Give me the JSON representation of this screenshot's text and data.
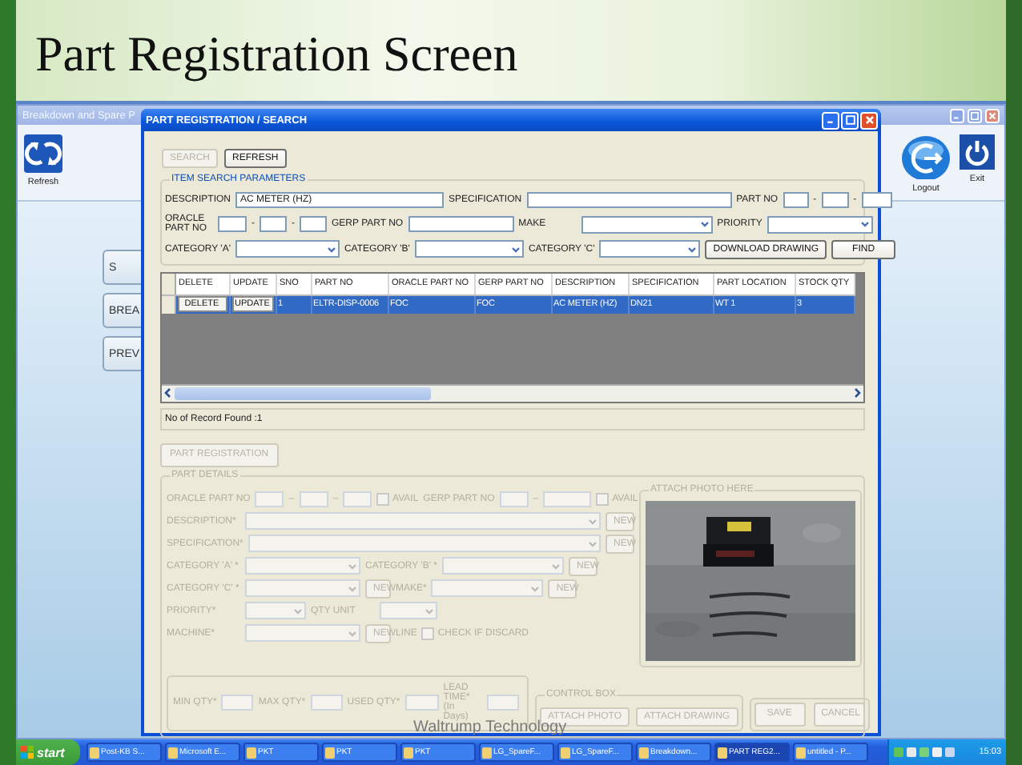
{
  "slide": {
    "title": "Part Registration Screen",
    "footer": "Waltrump Technology"
  },
  "main_window": {
    "title": "Breakdown and Spare P",
    "toolbar_left": [
      {
        "label": "Refresh"
      }
    ],
    "toolbar_right": [
      {
        "label": "Logout"
      },
      {
        "label": "Exit"
      }
    ],
    "menu_buttons": [
      "S",
      "BREA",
      "PREV"
    ]
  },
  "dialog": {
    "title": "PART REGISTRATION / SEARCH",
    "top_buttons": [
      {
        "label": "SEARCH",
        "disabled": true
      },
      {
        "label": "REFRESH",
        "disabled": false
      }
    ],
    "search_group": {
      "title": "ITEM SEARCH PARAMETERS",
      "rows": [
        {
          "fields": [
            {
              "kind": "label",
              "text": "DESCRIPTION"
            },
            {
              "kind": "input",
              "value": "AC METER (HZ)"
            },
            {
              "kind": "label",
              "text": "SPECIFICATION"
            },
            {
              "kind": "input"
            },
            {
              "kind": "label",
              "text": "PART NO"
            },
            {
              "kind": "input"
            },
            {
              "kind": "sep",
              "text": "-"
            },
            {
              "kind": "input"
            },
            {
              "kind": "sep",
              "text": "-"
            },
            {
              "kind": "input"
            }
          ]
        },
        {
          "fields": [
            {
              "kind": "label",
              "text": "ORACLE PART NO"
            },
            {
              "kind": "input"
            },
            {
              "kind": "sep",
              "text": "-"
            },
            {
              "kind": "input"
            },
            {
              "kind": "sep",
              "text": "-"
            },
            {
              "kind": "input"
            },
            {
              "kind": "label",
              "text": "GERP PART NO"
            },
            {
              "kind": "input"
            },
            {
              "kind": "label",
              "text": "MAKE"
            },
            {
              "kind": "select"
            },
            {
              "kind": "label",
              "text": "PRIORITY"
            },
            {
              "kind": "select"
            }
          ]
        },
        {
          "fields": [
            {
              "kind": "label",
              "text": "CATEGORY 'A'"
            },
            {
              "kind": "select"
            },
            {
              "kind": "label",
              "text": "CATEGORY 'B'"
            },
            {
              "kind": "select"
            },
            {
              "kind": "label",
              "text": "CATEGORY 'C'"
            },
            {
              "kind": "select"
            },
            {
              "kind": "button",
              "label": "DOWNLOAD DRAWING",
              "disabled": false
            },
            {
              "kind": "button",
              "label": "FIND",
              "disabled": false
            }
          ]
        }
      ]
    },
    "grid": {
      "columns": [
        "DELETE",
        "UPDATE",
        "SNO",
        "PART NO",
        "ORACLE PART NO",
        "GERP PART NO",
        "DESCRIPTION",
        "SPECIFICATION",
        "PART LOCATION",
        "STOCK QTY"
      ],
      "rows": [
        {
          "selected": true,
          "cells": [
            {
              "kind": "button",
              "text": "DELETE"
            },
            {
              "kind": "button",
              "text": "UPDATE"
            },
            {
              "kind": "text",
              "text": "1"
            },
            {
              "kind": "text",
              "text": "ELTR-DISP-0006"
            },
            {
              "kind": "text",
              "text": "FOC"
            },
            {
              "kind": "text",
              "text": "FOC"
            },
            {
              "kind": "text",
              "text": "AC METER (HZ)"
            },
            {
              "kind": "text",
              "text": "DN21"
            },
            {
              "kind": "text",
              "text": "WT 1"
            },
            {
              "kind": "text",
              "text": "3"
            }
          ]
        }
      ]
    },
    "record_count": "No of Record Found :1",
    "register_button": {
      "label": "PART REGISTRATION",
      "disabled": true
    },
    "details_group": {
      "title": "PART DETAILS",
      "disabled": true,
      "rows": [
        {
          "fields": [
            {
              "kind": "label",
              "text": "ORACLE PART NO"
            },
            {
              "kind": "input"
            },
            {
              "kind": "sep",
              "text": "–"
            },
            {
              "kind": "input"
            },
            {
              "kind": "sep",
              "text": "–"
            },
            {
              "kind": "input"
            },
            {
              "kind": "checkbox",
              "label": "AVAIL",
              "checked": false
            },
            {
              "kind": "label",
              "text": "GERP PART NO"
            },
            {
              "kind": "input"
            },
            {
              "kind": "sep",
              "text": "–"
            },
            {
              "kind": "input"
            },
            {
              "kind": "checkbox",
              "label": "AVAIL",
              "checked": false
            }
          ]
        },
        {
          "fields": [
            {
              "kind": "label",
              "text": "DESCRIPTION*"
            },
            {
              "kind": "select"
            },
            {
              "kind": "button",
              "label": "NEW",
              "disabled": true
            }
          ]
        },
        {
          "fields": [
            {
              "kind": "label",
              "text": "SPECIFICATION*"
            },
            {
              "kind": "select"
            },
            {
              "kind": "button",
              "label": "NEW",
              "disabled": true
            }
          ]
        },
        {
          "fields": [
            {
              "kind": "label",
              "text": "CATEGORY 'A' *"
            },
            {
              "kind": "select"
            },
            {
              "kind": "label",
              "text": "CATEGORY 'B' *"
            },
            {
              "kind": "select"
            },
            {
              "kind": "button",
              "label": "NEW",
              "disabled": true
            }
          ]
        },
        {
          "fields": [
            {
              "kind": "label",
              "text": "CATEGORY 'C' *"
            },
            {
              "kind": "select"
            },
            {
              "kind": "button",
              "label": "NEW",
              "disabled": true
            },
            {
              "kind": "label",
              "text": "MAKE*"
            },
            {
              "kind": "select"
            },
            {
              "kind": "button",
              "label": "NEW",
              "disabled": true
            }
          ]
        },
        {
          "fields": [
            {
              "kind": "label",
              "text": "PRIORITY*"
            },
            {
              "kind": "select"
            },
            {
              "kind": "label",
              "text": "QTY UNIT"
            },
            {
              "kind": "select"
            }
          ]
        },
        {
          "fields": [
            {
              "kind": "label",
              "text": "MACHINE*"
            },
            {
              "kind": "select"
            },
            {
              "kind": "button",
              "label": "NEW",
              "disabled": true
            },
            {
              "kind": "label",
              "text": "LINE"
            },
            {
              "kind": "checkbox",
              "label": "CHECK IF DISCARD",
              "checked": false
            }
          ]
        }
      ],
      "quantity_row": {
        "fields": [
          {
            "kind": "label",
            "text": "MIN QTY*"
          },
          {
            "kind": "input"
          },
          {
            "kind": "label",
            "text": "MAX QTY*"
          },
          {
            "kind": "input"
          },
          {
            "kind": "label",
            "text": "USED QTY*"
          },
          {
            "kind": "input"
          },
          {
            "kind": "label",
            "text": "LEAD TIME* (In Days)"
          },
          {
            "kind": "input"
          }
        ]
      },
      "photo_group": {
        "title": "ATTACH PHOTO HERE",
        "kind": "picture"
      },
      "control_box": {
        "title": "CONTROL BOX",
        "buttons": [
          {
            "label": "ATTACH PHOTO",
            "disabled": true
          },
          {
            "label": "ATTACH DRAWING",
            "disabled": true
          }
        ]
      },
      "actions": [
        {
          "label": "SAVE",
          "disabled": true
        },
        {
          "label": "CANCEL",
          "disabled": true
        }
      ]
    }
  },
  "taskbar": {
    "start": "start",
    "tasks": [
      {
        "label": "Post-KB S...",
        "selected": false
      },
      {
        "label": "Microsoft E...",
        "selected": false
      },
      {
        "label": "PKT",
        "selected": false
      },
      {
        "label": "PKT",
        "selected": false
      },
      {
        "label": "PKT",
        "selected": false
      },
      {
        "label": "LG_SpareF...",
        "selected": false
      },
      {
        "label": "LG_SpareF...",
        "selected": false
      },
      {
        "label": "Breakdown...",
        "selected": false
      },
      {
        "label": "PART REG2...",
        "selected": true
      },
      {
        "label": "untitled - P...",
        "selected": false
      }
    ],
    "clock": "15:03"
  }
}
